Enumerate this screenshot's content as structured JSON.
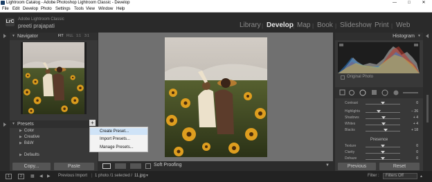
{
  "window": {
    "title": "Lightroom Catalog - Adobe Photoshop Lightroom Classic - Develop",
    "controls": {
      "minimize": "—",
      "maximize": "□",
      "close": "✕"
    }
  },
  "menubar": [
    "File",
    "Edit",
    "Develop",
    "Photo",
    "Settings",
    "Tools",
    "View",
    "Window",
    "Help"
  ],
  "identity": {
    "badge": "LrC",
    "app_line": "Adobe Lightroom Classic",
    "catalog_user": "preeti prajapati"
  },
  "modules": [
    "Library",
    "Develop",
    "Map",
    "Book",
    "Slideshow",
    "Print",
    "Web"
  ],
  "active_module": "Develop",
  "navigator": {
    "title": "Navigator",
    "zoom_options": [
      "FIT",
      "FILL",
      "1:1",
      "3:1"
    ]
  },
  "presets": {
    "title": "Presets",
    "add_symbol": "+",
    "items": [
      "Color",
      "Creative",
      "B&W",
      "Defaults"
    ]
  },
  "context_menu": [
    "Create Preset...",
    "Import Presets...",
    "Manage Presets..."
  ],
  "left_buttons": {
    "copy": "Copy...",
    "paste": "Paste"
  },
  "toolbar": {
    "soft_proofing": "Soft Proofing"
  },
  "histogram": {
    "title": "Histogram",
    "original_photo": "Original Photo"
  },
  "basic": {
    "sliders": [
      {
        "label": "Contrast",
        "value": "0"
      },
      {
        "label": "Highlights",
        "value": "− 26"
      },
      {
        "label": "Shadows",
        "value": "+ 4"
      },
      {
        "label": "Whites",
        "value": "+ 4"
      },
      {
        "label": "Blacks",
        "value": "+ 18"
      }
    ],
    "presence_title": "Presence",
    "presence_sliders": [
      {
        "label": "Texture",
        "value": "0"
      },
      {
        "label": "Clarity",
        "value": "0"
      },
      {
        "label": "Dehaze",
        "value": "0"
      }
    ]
  },
  "right_buttons": {
    "previous": "Previous",
    "reset": "Reset"
  },
  "filmstrip": {
    "screen_a": "1",
    "screen_b": "2",
    "source": "Previous Import",
    "count": "1 photo /1 selected /",
    "filename": "11.jpg",
    "filter_label": "Filter :",
    "filter_value": "Filters Off"
  },
  "colors": {
    "accent_active": "#e8e8e8",
    "panel": "#383838",
    "menu_highlight": "#cfe3f7"
  }
}
